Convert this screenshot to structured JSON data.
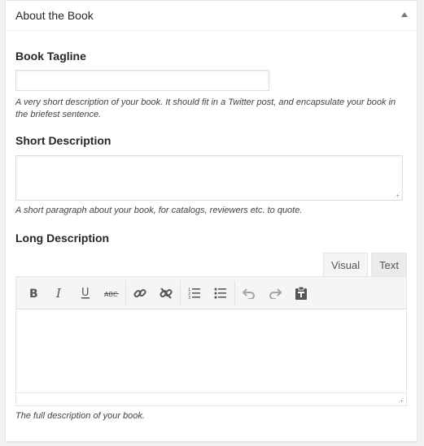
{
  "metabox": {
    "title": "About the Book"
  },
  "tagline": {
    "label": "Book Tagline",
    "value": "",
    "description": "A very short description of your book. It should fit in a Twitter post, and encapsulate your book in the briefest sentence."
  },
  "short_description": {
    "label": "Short Description",
    "value": "",
    "description": "A short paragraph about your book, for catalogs, reviewers etc. to quote."
  },
  "long_description": {
    "label": "Long Description",
    "tabs": {
      "visual": "Visual",
      "text": "Text"
    },
    "active_tab": "Visual",
    "toolbar": [
      "bold-icon",
      "italic-icon",
      "underline-icon",
      "strikethrough-icon",
      "link-icon",
      "unlink-icon",
      "ordered-list-icon",
      "unordered-list-icon",
      "undo-icon",
      "redo-icon",
      "paste-as-text-icon"
    ],
    "value": "",
    "description": "The full description of your book."
  }
}
